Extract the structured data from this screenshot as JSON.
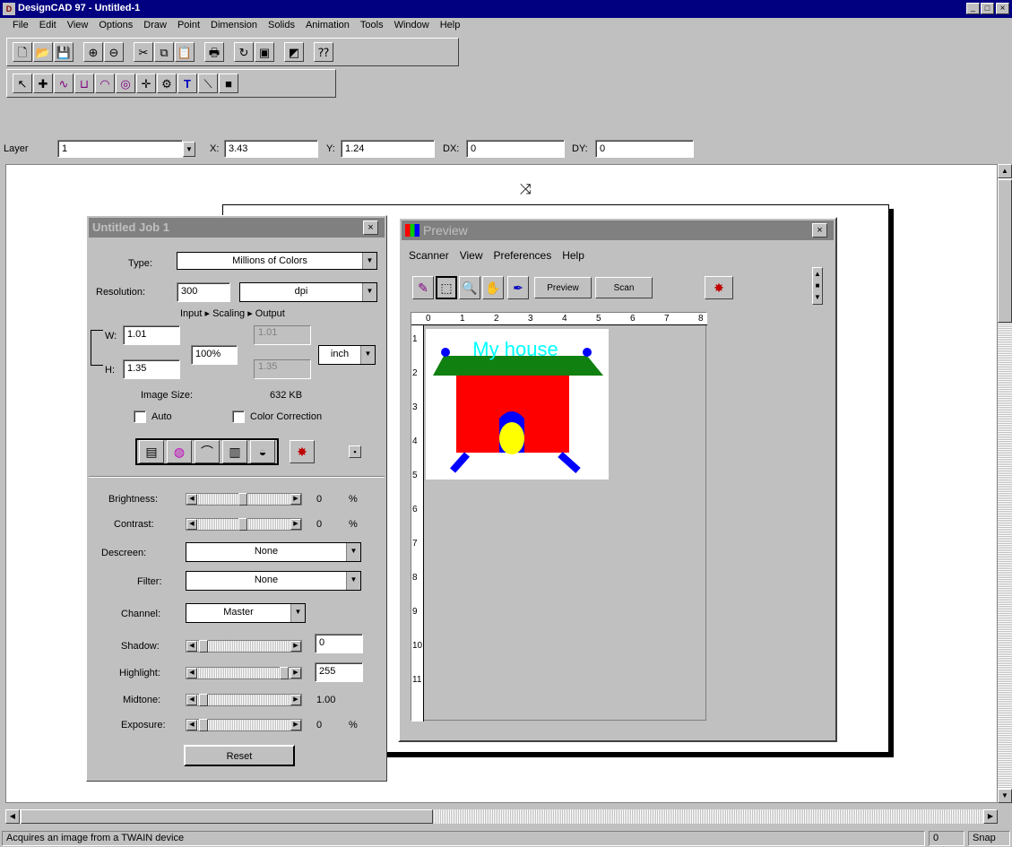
{
  "titlebar": {
    "title": "DesignCAD 97 - Untitled-1"
  },
  "menu": [
    "File",
    "Edit",
    "View",
    "Options",
    "Draw",
    "Point",
    "Dimension",
    "Solids",
    "Animation",
    "Tools",
    "Window",
    "Help"
  ],
  "toolbar1": [
    {
      "name": "new-file-icon",
      "glyph": "🗋"
    },
    {
      "name": "open-file-icon",
      "glyph": "📂"
    },
    {
      "name": "save-icon",
      "glyph": "💾"
    },
    {
      "name": "zoom-in-icon",
      "glyph": "⊕"
    },
    {
      "name": "zoom-out-icon",
      "glyph": "⊖"
    },
    {
      "name": "cut-icon",
      "glyph": "✂"
    },
    {
      "name": "copy-icon",
      "glyph": "⧉"
    },
    {
      "name": "paste-icon",
      "glyph": "📋"
    },
    {
      "name": "print-icon",
      "glyph": "🖶"
    },
    {
      "name": "redraw-icon",
      "glyph": "↻"
    },
    {
      "name": "window-icon",
      "glyph": "▣"
    },
    {
      "name": "acquire-image-icon",
      "glyph": "◩"
    },
    {
      "name": "help-pointer-icon",
      "glyph": "⁇"
    }
  ],
  "toolbar2": [
    {
      "name": "select-arrow-icon",
      "glyph": "↖"
    },
    {
      "name": "point-icon",
      "glyph": "✚"
    },
    {
      "name": "curve-icon",
      "glyph": "∿"
    },
    {
      "name": "box-icon",
      "glyph": "⊔"
    },
    {
      "name": "arc-icon",
      "glyph": "◠"
    },
    {
      "name": "circle-icon",
      "glyph": "◎"
    },
    {
      "name": "cross-icon",
      "glyph": "✛"
    },
    {
      "name": "gear-icon",
      "glyph": "⚙"
    },
    {
      "name": "text-icon",
      "glyph": "T"
    },
    {
      "name": "line-icon",
      "glyph": "⟍"
    },
    {
      "name": "color-swatch-icon",
      "glyph": "■"
    }
  ],
  "coordbar": {
    "layer_label": "Layer",
    "layer_value": "1",
    "x_label": "X:",
    "x_value": "3.43",
    "y_label": "Y:",
    "y_value": "1.24",
    "dx_label": "DX:",
    "dx_value": "0",
    "dy_label": "DY:",
    "dy_value": "0"
  },
  "statusbar": {
    "text": "Acquires an image from a TWAIN device",
    "field1": "0",
    "field2": "Snap"
  },
  "scan": {
    "title": "Untitled Job 1",
    "type_label": "Type:",
    "type_value": "Millions of Colors",
    "resolution_label": "Resolution:",
    "resolution_value": "300",
    "resolution_unit": "dpi",
    "scaling_label": "Input ▸ Scaling ▸ Output",
    "w_label": "W:",
    "w_value": "1.01",
    "h_label": "H:",
    "h_value": "1.35",
    "scale_value": "100%",
    "out_w": "1.01",
    "out_h": "1.35",
    "units_value": "inch",
    "image_size_label": "Image Size:",
    "image_size_value": "632 KB",
    "auto_label": "Auto",
    "color_correction_label": "Color Correction",
    "brightness_label": "Brightness:",
    "brightness_value": "0",
    "brightness_unit": "%",
    "contrast_label": "Contrast:",
    "contrast_value": "0",
    "contrast_unit": "%",
    "descreen_label": "Descreen:",
    "descreen_value": "None",
    "filter_label": "Filter:",
    "filter_value": "None",
    "channel_label": "Channel:",
    "channel_value": "Master",
    "shadow_label": "Shadow:",
    "shadow_value": "0",
    "highlight_label": "Highlight:",
    "highlight_value": "255",
    "midtone_label": "Midtone:",
    "midtone_value": "1.00",
    "exposure_label": "Exposure:",
    "exposure_value": "0",
    "exposure_unit": "%",
    "reset_label": "Reset"
  },
  "preview": {
    "title": "Preview",
    "menu": [
      "Scanner",
      "View",
      "Preferences",
      "Help"
    ],
    "preview_button": "Preview",
    "scan_button": "Scan",
    "ruler_top": [
      "0",
      "1",
      "2",
      "3",
      "4",
      "5",
      "6",
      "7",
      "8"
    ],
    "ruler_left": [
      "1",
      "2",
      "3",
      "4",
      "5",
      "6",
      "7",
      "8",
      "9",
      "10",
      "11"
    ],
    "image_text": "My house"
  },
  "colors": {
    "house_roof": "#108010",
    "house_wall": "#ff0000",
    "house_door": "#ffff00",
    "house_dark": "#0000ff",
    "house_text": "#00ffff"
  }
}
